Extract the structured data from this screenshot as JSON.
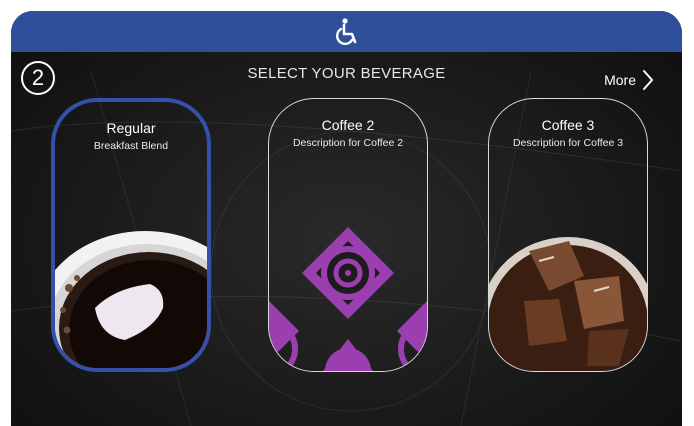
{
  "header": {
    "accessibility_icon": "wheelchair-icon",
    "color": "#2f4f9a"
  },
  "step": {
    "number": "2"
  },
  "page": {
    "title": "SELECT YOUR BEVERAGE",
    "more_label": "More"
  },
  "beverages": [
    {
      "name": "Regular",
      "description": "Breakfast Blend",
      "image": "hot-coffee-cup",
      "selected": true
    },
    {
      "name": "Coffee 2",
      "description": "Description for Coffee 2",
      "image": "purple-spiral-pattern",
      "selected": false
    },
    {
      "name": "Coffee 3",
      "description": "Description for Coffee 3",
      "image": "iced-coffee-glass",
      "selected": false
    }
  ],
  "colors": {
    "selected_border": "#3450a8",
    "accent_purple": "#9b3fb0"
  }
}
